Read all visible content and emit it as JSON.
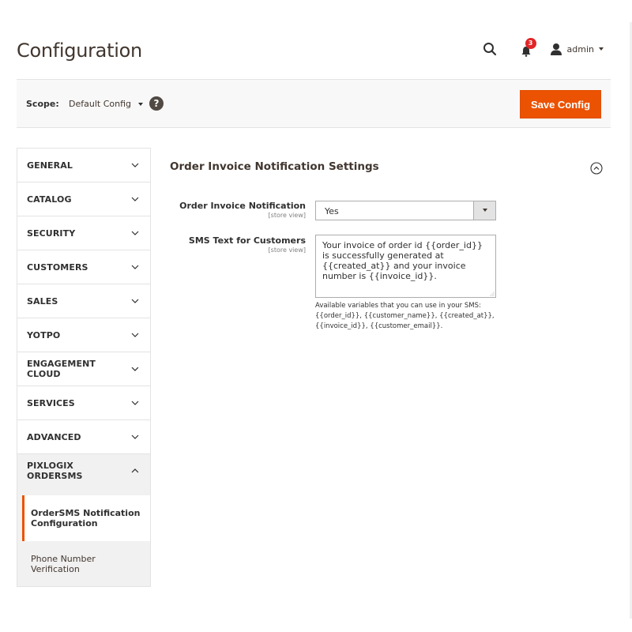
{
  "header": {
    "title": "Configuration",
    "search_icon": "search-icon",
    "notifications": {
      "icon": "bell-icon",
      "count": "3"
    },
    "user": {
      "icon": "user-icon",
      "name": "admin"
    }
  },
  "scope": {
    "label": "Scope:",
    "value": "Default Config",
    "help_icon": "?",
    "save_label": "Save Config"
  },
  "colors": {
    "accent": "#eb5202",
    "badge": "#e22626",
    "text": "#303030"
  },
  "sidebar": {
    "tabs": [
      {
        "label": "GENERAL",
        "expanded": false
      },
      {
        "label": "CATALOG",
        "expanded": false
      },
      {
        "label": "SECURITY",
        "expanded": false
      },
      {
        "label": "CUSTOMERS",
        "expanded": false
      },
      {
        "label": "SALES",
        "expanded": false
      },
      {
        "label": "YOTPO",
        "expanded": false
      },
      {
        "label": "ENGAGEMENT CLOUD",
        "expanded": false
      },
      {
        "label": "SERVICES",
        "expanded": false
      },
      {
        "label": "ADVANCED",
        "expanded": false
      },
      {
        "label": "PIXLOGIX ORDERSMS",
        "expanded": true
      }
    ],
    "subitems": [
      {
        "label": "OrderSMS Notification Configuration",
        "active": true
      },
      {
        "label": "Phone Number Verification",
        "active": false
      }
    ]
  },
  "main": {
    "section_title": "Order Invoice Notification Settings",
    "fields": [
      {
        "label": "Order Invoice Notification",
        "scope": "[store view]",
        "type": "select",
        "value": "Yes"
      },
      {
        "label": "SMS Text for Customers",
        "scope": "[store view]",
        "type": "textarea",
        "value": "Your invoice of order id {{order_id}} is successfully generated at {{created_at}} and your invoice number is {{invoice_id}}.",
        "note": "Available variables that you can use in your SMS: {{order_id}}, {{customer_name}}, {{created_at}}, {{invoice_id}}, {{customer_email}}."
      }
    ]
  }
}
